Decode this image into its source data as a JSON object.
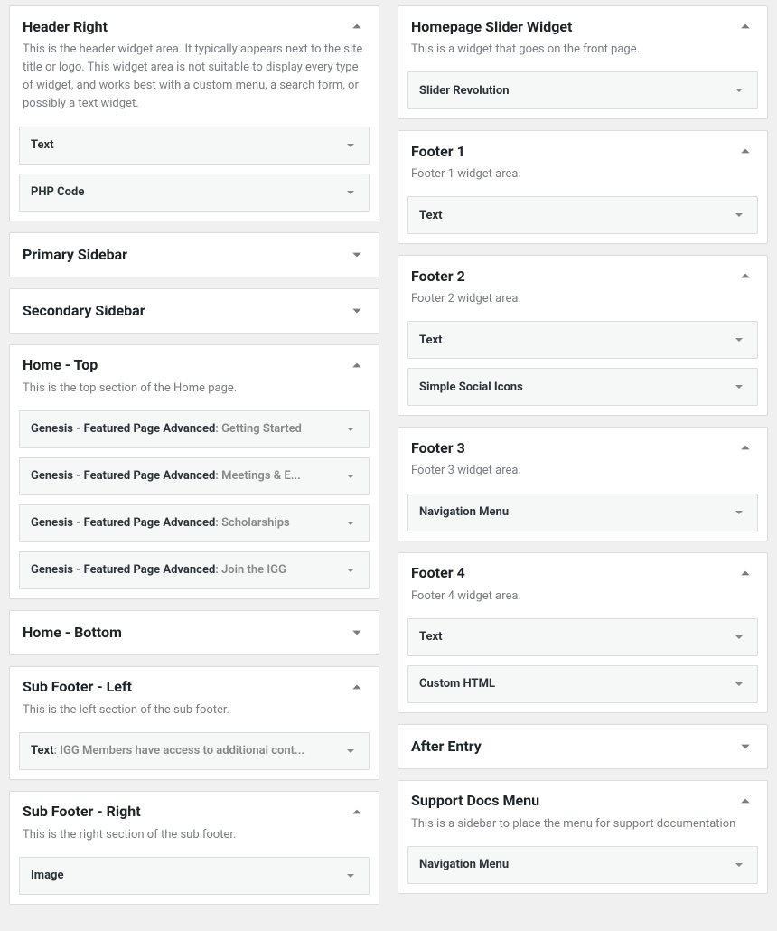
{
  "left": [
    {
      "title": "Header Right",
      "desc": "This is the header widget area. It typically appears next to the site title or logo. This widget area is not suitable to display every type of widget, and works best with a custom menu, a search form, or possibly a text widget.",
      "open": true,
      "widgets": [
        {
          "label": "Text"
        },
        {
          "label": "PHP Code"
        }
      ]
    },
    {
      "title": "Primary Sidebar",
      "open": false
    },
    {
      "title": "Secondary Sidebar",
      "open": false
    },
    {
      "title": "Home - Top",
      "desc": "This is the top section of the Home page.",
      "open": true,
      "widgets": [
        {
          "label": "Genesis - Featured Page Advanced",
          "sub": "Getting Started"
        },
        {
          "label": "Genesis - Featured Page Advanced",
          "sub": "Meetings & E..."
        },
        {
          "label": "Genesis - Featured Page Advanced",
          "sub": "Scholarships"
        },
        {
          "label": "Genesis - Featured Page Advanced",
          "sub": "Join the IGG"
        }
      ]
    },
    {
      "title": "Home - Bottom",
      "open": false
    },
    {
      "title": "Sub Footer - Left",
      "desc": "This is the left section of the sub footer.",
      "open": true,
      "widgets": [
        {
          "label": "Text",
          "sub": "IGG Members have access to additional cont..."
        }
      ]
    },
    {
      "title": "Sub Footer - Right",
      "desc": "This is the right section of the sub footer.",
      "open": true,
      "widgets": [
        {
          "label": "Image"
        }
      ]
    }
  ],
  "right": [
    {
      "title": "Homepage Slider Widget",
      "desc": "This is a widget that goes on the front page.",
      "open": true,
      "widgets": [
        {
          "label": "Slider Revolution"
        }
      ]
    },
    {
      "title": "Footer 1",
      "desc": "Footer 1 widget area.",
      "open": true,
      "widgets": [
        {
          "label": "Text"
        }
      ]
    },
    {
      "title": "Footer 2",
      "desc": "Footer 2 widget area.",
      "open": true,
      "widgets": [
        {
          "label": "Text"
        },
        {
          "label": "Simple Social Icons"
        }
      ]
    },
    {
      "title": "Footer 3",
      "desc": "Footer 3 widget area.",
      "open": true,
      "widgets": [
        {
          "label": "Navigation Menu"
        }
      ]
    },
    {
      "title": "Footer 4",
      "desc": "Footer 4 widget area.",
      "open": true,
      "widgets": [
        {
          "label": "Text"
        },
        {
          "label": "Custom HTML"
        }
      ]
    },
    {
      "title": "After Entry",
      "open": false
    },
    {
      "title": "Support Docs Menu",
      "desc": "This is a sidebar to place the menu for support documentation",
      "open": true,
      "widgets": [
        {
          "label": "Navigation Menu"
        }
      ]
    }
  ]
}
